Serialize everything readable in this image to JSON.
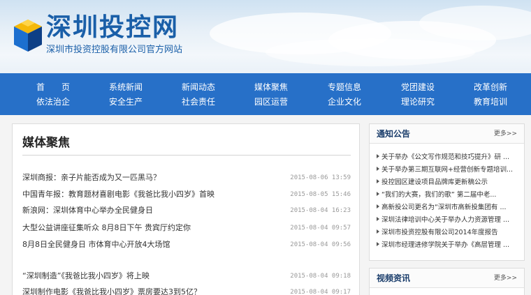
{
  "header": {
    "logo_title": "深圳投控网",
    "logo_subtitle": "深圳市投资控股有限公司官方网站"
  },
  "nav": {
    "row1": [
      "首　　页",
      "系统新闻",
      "新闻动态",
      "媒体聚焦",
      "专题信息",
      "党团建设",
      "改革创新"
    ],
    "row2": [
      "依法治企",
      "安全生产",
      "社会责任",
      "园区运营",
      "企业文化",
      "理论研究",
      "教育培训"
    ]
  },
  "main": {
    "title": "媒体聚焦",
    "news": [
      {
        "title": "深圳商报：亲子片能否成为又一匹黑马？",
        "date": "2015-08-06 13:59"
      },
      {
        "title": "中国青年报：教育题材喜剧电影《我爸比我小四岁》首映",
        "date": "2015-08-05 15:46"
      },
      {
        "title": "新浪网：深圳体育中心举办全民健身日",
        "date": "2015-08-04 16:23"
      },
      {
        "title": "大型公益讲座征集听众 8月8日下午 贵宾厅约定你",
        "date": "2015-08-04 09:57"
      },
      {
        "title": "8月8日全民健身日 市体育中心开放4大场馆",
        "date": "2015-08-04 09:56"
      },
      {
        "title": "“深圳制造”《我爸比我小四岁》将上映",
        "date": "2015-08-04 09:18"
      },
      {
        "title": "深圳制作电影《我爸比我小四岁》票房要达3到5亿？",
        "date": "2015-08-04 09:17"
      }
    ]
  },
  "notice": {
    "title": "通知公告",
    "more": "更多>>",
    "items": [
      "关于举办《公文写作规范和技巧提升》研 ...",
      "关于举办第三期互联网+经营创新专题培训...",
      "投控园区建设项目品牌库更新稿公示",
      "“我们的大赛，我们的歌” 第二届中老...",
      "高新投公司更名为“深圳市高新投集团有 ...",
      "深圳法律培训中心关于举办人力资源管理 ...",
      "深圳市投资控股有限公司2014年度报告",
      "深圳市经理进修学院关于举办《高层管理 ..."
    ]
  },
  "video": {
    "title": "视频资讯",
    "more": "更多>>"
  },
  "colors": {
    "nav_bg": "#2770c8",
    "brand_blue": "#1a5fa8",
    "cube_yellow": "#f5b90a",
    "cube_blue": "#1c6fcf",
    "cube_dark": "#0d3f86"
  }
}
